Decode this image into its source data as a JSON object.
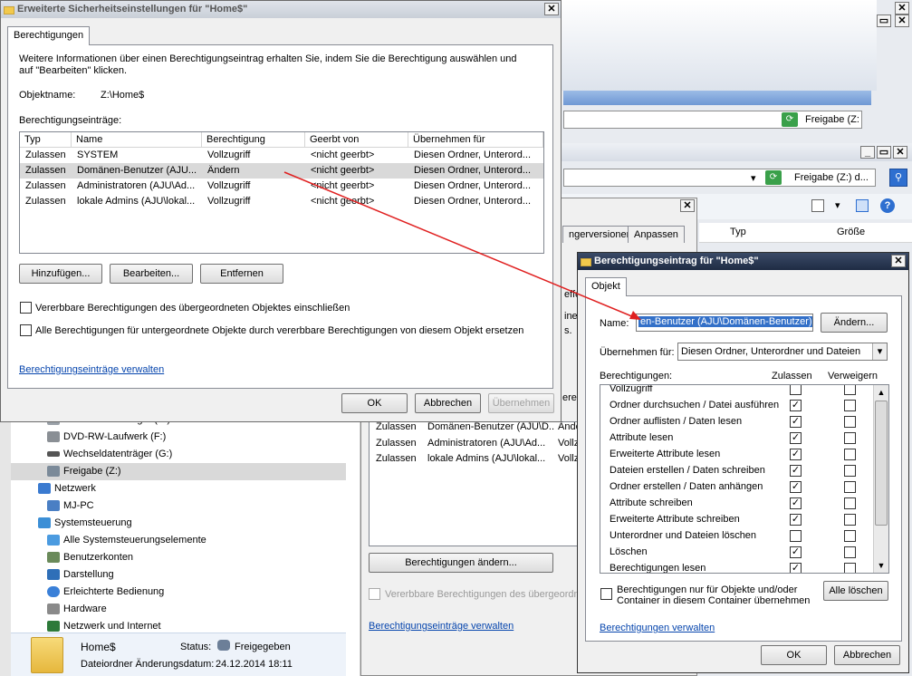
{
  "bg_explorer": {
    "address_share": "Freigabe (Z:",
    "address_share2": "Freigabe (Z:) d...",
    "column_headers": [
      "Typ",
      "Größe"
    ],
    "sharing_tabs": [
      "ngerversionen",
      "Anpassen"
    ],
    "tree": [
      {
        "label": "Lokaler Datenträger (E:)",
        "icon": "drive-icon"
      },
      {
        "label": "DVD-RW-Laufwerk (F:)",
        "icon": "dvd-drive-icon"
      },
      {
        "label": "Wechseldatenträger (G:)",
        "icon": "removable-drive-icon"
      },
      {
        "label": "Freigabe (Z:)",
        "icon": "network-drive-icon",
        "selected": true
      },
      {
        "label": "Netzwerk",
        "icon": "network-icon"
      },
      {
        "label": "MJ-PC",
        "icon": "computer-icon"
      },
      {
        "label": "Systemsteuerung",
        "icon": "control-panel-icon"
      },
      {
        "label": "Alle Systemsteuerungselemente",
        "icon": "control-panel-items-icon"
      },
      {
        "label": "Benutzerkonten",
        "icon": "user-accounts-icon"
      },
      {
        "label": "Darstellung",
        "icon": "appearance-icon"
      },
      {
        "label": "Erleichterte Bedienung",
        "icon": "ease-of-access-icon"
      },
      {
        "label": "Hardware",
        "icon": "hardware-icon"
      },
      {
        "label": "Netzwerk und Internet",
        "icon": "network-internet-icon"
      }
    ],
    "details": {
      "name": "Home$",
      "status_label": "Status:",
      "status_value": "Freigegeben",
      "modified_label": "Dateiordner Änderungsdatum:",
      "modified_value": "24.12.2014 18:11"
    },
    "behind_rows": [
      [
        "Zulassen",
        "Domänen-Benutzer (AJU\\D...",
        "Ände"
      ],
      [
        "Zulassen",
        "Administratoren (AJU\\Ad...",
        "Vollz"
      ],
      [
        "Zulassen",
        "lokale Admins (AJU\\lokal...",
        "Vollz"
      ]
    ],
    "behind_change_btn": "Berechtigungen ändern...",
    "behind_inherit": "Vererbbare Berechtigungen des übergeordne",
    "behind_link": "Berechtigungseinträge verwalten",
    "behind_fragments": [
      "effe",
      "ine",
      "s.",
      "ere"
    ]
  },
  "adv_dialog": {
    "title": "Erweiterte Sicherheitseinstellungen für \"Home$\"",
    "tab": "Berechtigungen",
    "info": "Weitere Informationen über einen Berechtigungseintrag erhalten Sie, indem Sie die Berechtigung auswählen und auf \"Bearbeiten\" klicken.",
    "object_label": "Objektname:",
    "object_value": "Z:\\Home$",
    "entries_label": "Berechtigungseinträge:",
    "columns": [
      "Typ",
      "Name",
      "Berechtigung",
      "Geerbt von",
      "Übernehmen für"
    ],
    "rows": [
      [
        "Zulassen",
        "SYSTEM",
        "Vollzugriff",
        "<nicht geerbt>",
        "Diesen Ordner, Unterord..."
      ],
      [
        "Zulassen",
        "Domänen-Benutzer (AJU...",
        "Ändern",
        "<nicht geerbt>",
        "Diesen Ordner, Unterord..."
      ],
      [
        "Zulassen",
        "Administratoren (AJU\\Ad...",
        "Vollzugriff",
        "<nicht geerbt>",
        "Diesen Ordner, Unterord..."
      ],
      [
        "Zulassen",
        "lokale Admins (AJU\\lokal...",
        "Vollzugriff",
        "<nicht geerbt>",
        "Diesen Ordner, Unterord..."
      ]
    ],
    "selected_row": 1,
    "add_btn": "Hinzufügen...",
    "edit_btn": "Bearbeiten...",
    "remove_btn": "Entfernen",
    "cb_inherit": "Vererbbare Berechtigungen des übergeordneten Objektes einschließen",
    "cb_replace": "Alle Berechtigungen für untergeordnete Objekte durch vererbbare Berechtigungen von diesem Objekt ersetzen",
    "link": "Berechtigungseinträge verwalten",
    "ok": "OK",
    "cancel": "Abbrechen",
    "apply": "Übernehmen"
  },
  "entry_dialog": {
    "title": "Berechtigungseintrag für \"Home$\"",
    "tab": "Objekt",
    "name_label": "Name:",
    "name_value": "en-Benutzer (AJU\\Domänen-Benutzer)",
    "change_btn": "Ändern...",
    "apply_label": "Übernehmen für:",
    "apply_value": "Diesen Ordner, Unterordner und Dateien",
    "perm_label": "Berechtigungen:",
    "allow_label": "Zulassen",
    "deny_label": "Verweigern",
    "perms": [
      {
        "label": "Vollzugriff",
        "allow": false,
        "deny": false
      },
      {
        "label": "Ordner durchsuchen / Datei ausführen",
        "allow": true,
        "deny": false
      },
      {
        "label": "Ordner auflisten / Daten lesen",
        "allow": true,
        "deny": false
      },
      {
        "label": "Attribute lesen",
        "allow": true,
        "deny": false
      },
      {
        "label": "Erweiterte Attribute lesen",
        "allow": true,
        "deny": false
      },
      {
        "label": "Dateien erstellen / Daten schreiben",
        "allow": true,
        "deny": false
      },
      {
        "label": "Ordner erstellen / Daten anhängen",
        "allow": true,
        "deny": false
      },
      {
        "label": "Attribute schreiben",
        "allow": true,
        "deny": false
      },
      {
        "label": "Erweiterte Attribute schreiben",
        "allow": true,
        "deny": false
      },
      {
        "label": "Unterordner und Dateien löschen",
        "allow": false,
        "deny": false
      },
      {
        "label": "Löschen",
        "allow": true,
        "deny": false
      },
      {
        "label": "Berechtigungen lesen",
        "allow": true,
        "deny": false
      }
    ],
    "cb_only_line1": "Berechtigungen nur für Objekte und/oder",
    "cb_only_line2": "Container in diesem Container übernehmen",
    "clear_all": "Alle löschen",
    "link": "Berechtigungen verwalten",
    "ok": "OK",
    "cancel": "Abbrechen"
  },
  "colors": {
    "arrow": "#e02020",
    "selection": "#d9d9d9",
    "link": "#0645ad"
  }
}
